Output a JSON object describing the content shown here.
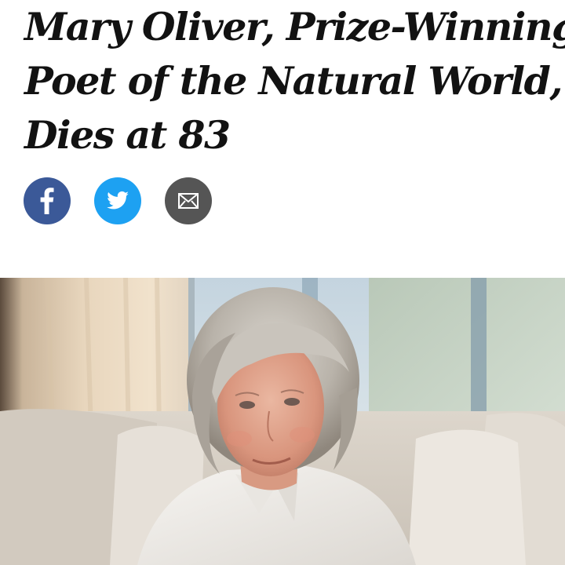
{
  "headline": {
    "lines": [
      "Mary Oliver, Prize-Winning",
      "Poet of the Natural World,",
      "Dies at 83"
    ]
  },
  "share": {
    "buttons": [
      {
        "icon": "facebook-icon",
        "color": "#3b5998"
      },
      {
        "icon": "twitter-icon",
        "color": "#1da1f2"
      },
      {
        "icon": "email-icon",
        "color": "#555555"
      }
    ]
  },
  "colors": {
    "headline_text": "#121212",
    "page_background": "#ffffff"
  }
}
